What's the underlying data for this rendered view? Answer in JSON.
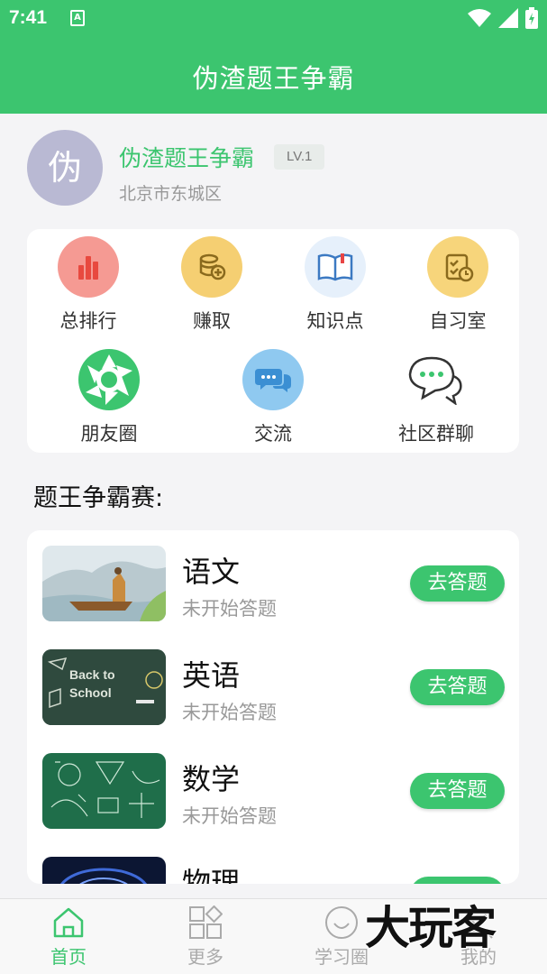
{
  "status_bar": {
    "time": "7:41",
    "notification_badge": "A"
  },
  "header": {
    "title": "伪渣题王争霸"
  },
  "profile": {
    "avatar_char": "伪",
    "name": "伪渣题王争霸",
    "level": "LV.1",
    "location": "北京市东城区"
  },
  "menu": {
    "items": [
      {
        "label": "总排行",
        "icon": "ranking-bar-chart-icon",
        "color": "#f59a93"
      },
      {
        "label": "赚取",
        "icon": "coins-icon",
        "color": "#f5cf72"
      },
      {
        "label": "知识点",
        "icon": "book-icon",
        "color": "#e6f0fb"
      },
      {
        "label": "自习室",
        "icon": "checklist-clock-icon",
        "color": "#f7d57b"
      },
      {
        "label": "朋友圈",
        "icon": "aperture-icon",
        "color": "#3cc56f"
      },
      {
        "label": "交流",
        "icon": "chat-bubbles-icon",
        "color": "#8fc9f0"
      },
      {
        "label": "社区群聊",
        "icon": "wechat-group-icon",
        "color": "#ffffff"
      }
    ]
  },
  "section": {
    "title": "题王争霸赛:"
  },
  "subjects": [
    {
      "name": "语文",
      "status": "未开始答题",
      "button": "去答题",
      "thumb_text": ""
    },
    {
      "name": "英语",
      "status": "未开始答题",
      "button": "去答题",
      "thumb_text": "Back to School"
    },
    {
      "name": "数学",
      "status": "未开始答题",
      "button": "去答题",
      "thumb_text": ""
    },
    {
      "name": "物理",
      "status": "",
      "button": "",
      "thumb_text": ""
    }
  ],
  "tabs": [
    {
      "label": "首页",
      "icon": "home-icon",
      "active": true
    },
    {
      "label": "更多",
      "icon": "grid-more-icon",
      "active": false
    },
    {
      "label": "学习圈",
      "icon": "smile-circle-icon",
      "active": false
    },
    {
      "label": "我的",
      "icon": "profile-icon",
      "active": false
    }
  ],
  "watermark": {
    "text": "大玩客"
  },
  "colors": {
    "primary": "#3cc56f",
    "background": "#f4f4f6",
    "muted_text": "#999999"
  }
}
